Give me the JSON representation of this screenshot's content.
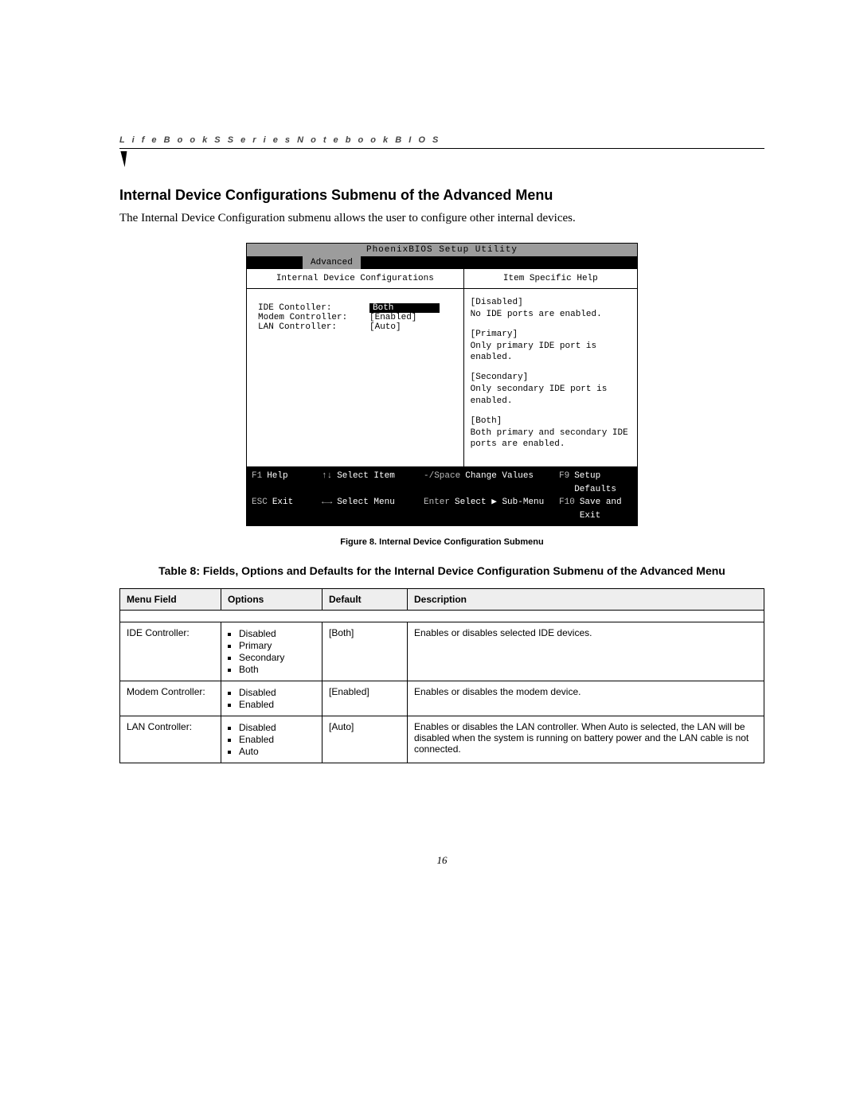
{
  "header": {
    "running": "L i f e B o o k   S   S e r i e s   N o t e b o o k   B I O S"
  },
  "section": {
    "title": "Internal Device Configurations Submenu of the Advanced Menu",
    "intro": "The Internal Device Configuration submenu allows the user to configure other internal devices."
  },
  "bios": {
    "title": "PhoenixBIOS Setup Utility",
    "menu_active": "Advanced",
    "left_heading": "Internal Device Configurations",
    "right_heading": "Item Specific Help",
    "fields": [
      {
        "label": "IDE Contoller:",
        "value": "Both",
        "selected": true
      },
      {
        "label": "Modem Controller:",
        "value": "[Enabled]",
        "selected": false
      },
      {
        "label": "LAN Controller:",
        "value": "[Auto]",
        "selected": false
      }
    ],
    "help": [
      "[Disabled]\nNo IDE ports are enabled.",
      "[Primary]\nOnly primary IDE port is enabled.",
      "[Secondary]\nOnly secondary IDE port is enabled.",
      "[Both]\nBoth primary and secondary IDE ports are enabled."
    ],
    "footer": {
      "r1": {
        "k1": "F1",
        "t1": "Help",
        "k2": "↑↓",
        "t2": "Select Item",
        "k3": "-/Space",
        "t3": "Change Values",
        "k4": "F9",
        "t4": "Setup Defaults"
      },
      "r2": {
        "k1": "ESC",
        "t1": "Exit",
        "k2": "←→",
        "t2": "Select Menu",
        "k3": "Enter",
        "t3": "Select ▶ Sub-Menu",
        "k4": "F10",
        "t4": "Save and Exit"
      }
    }
  },
  "figure_caption": "Figure 8.   Internal Device Configuration Submenu",
  "table_caption": "Table 8: Fields, Options and Defaults for the Internal Device Configuration Submenu of the Advanced Menu",
  "table": {
    "headers": [
      "Menu Field",
      "Options",
      "Default",
      "Description"
    ],
    "rows": [
      {
        "field": "IDE Controller:",
        "options": [
          "Disabled",
          "Primary",
          "Secondary",
          "Both"
        ],
        "default": "[Both]",
        "desc": "Enables or disables selected IDE devices."
      },
      {
        "field": "Modem Controller:",
        "options": [
          "Disabled",
          "Enabled"
        ],
        "default": "[Enabled]",
        "desc": "Enables or disables the modem device."
      },
      {
        "field": "LAN Controller:",
        "options": [
          "Disabled",
          "Enabled",
          "Auto"
        ],
        "default": "[Auto]",
        "desc": "Enables or disables the LAN controller. When Auto is selected, the LAN will be disabled when the system is running on battery power and the LAN cable is not connected."
      }
    ]
  },
  "page_number": "16"
}
